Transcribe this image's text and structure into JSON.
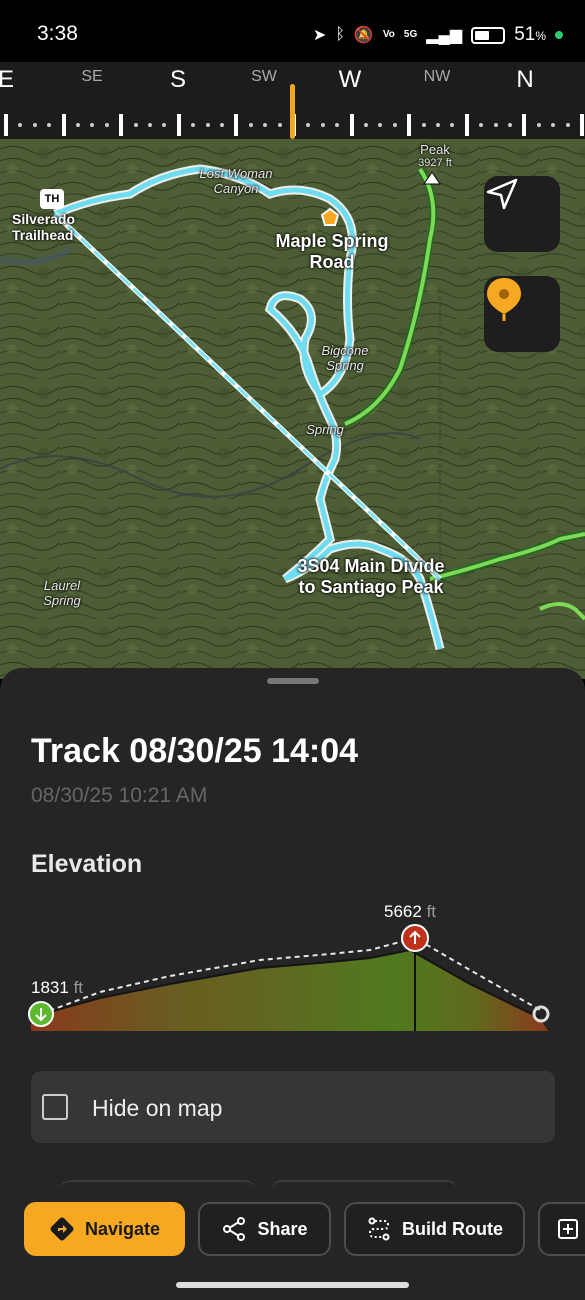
{
  "status_bar": {
    "time": "3:38",
    "network": "5G",
    "battery_percent": "51",
    "percent_sign": "%"
  },
  "compass": {
    "labels": [
      "E",
      "SE",
      "S",
      "SW",
      "W",
      "NW",
      "N"
    ]
  },
  "map": {
    "labels": {
      "trailhead_badge": "TH",
      "trailhead": "Silverado Trailhead",
      "canyon": "Lost Woman Canyon",
      "maple_road": "Maple Spring Road",
      "bigcone": "Bigcone Spring",
      "spring": "Spring",
      "main_divide": "3S04 Main Divide to Santiago Peak",
      "laurel": "Laurel Spring",
      "peak": "Peak",
      "peak_elev": "3927 ft"
    },
    "buttons": {
      "locate_icon": "navigation-arrow-icon",
      "pin_icon": "orange-pin-icon"
    }
  },
  "sheet": {
    "title": "Track 08/30/25 14:04",
    "date": "08/30/25 10:21 AM",
    "elevation_heading": "Elevation",
    "min_elevation": "1831",
    "max_elevation": "5662",
    "unit": "ft",
    "hide_on_map_label": "Hide on map"
  },
  "actions": {
    "navigate": "Navigate",
    "share": "Share",
    "build_route": "Build Route"
  },
  "colors": {
    "accent": "#f7a823",
    "track": "#7fe3f5",
    "trail": "#6fd15a",
    "max_marker": "#c0311c",
    "min_marker": "#5cb82e"
  }
}
